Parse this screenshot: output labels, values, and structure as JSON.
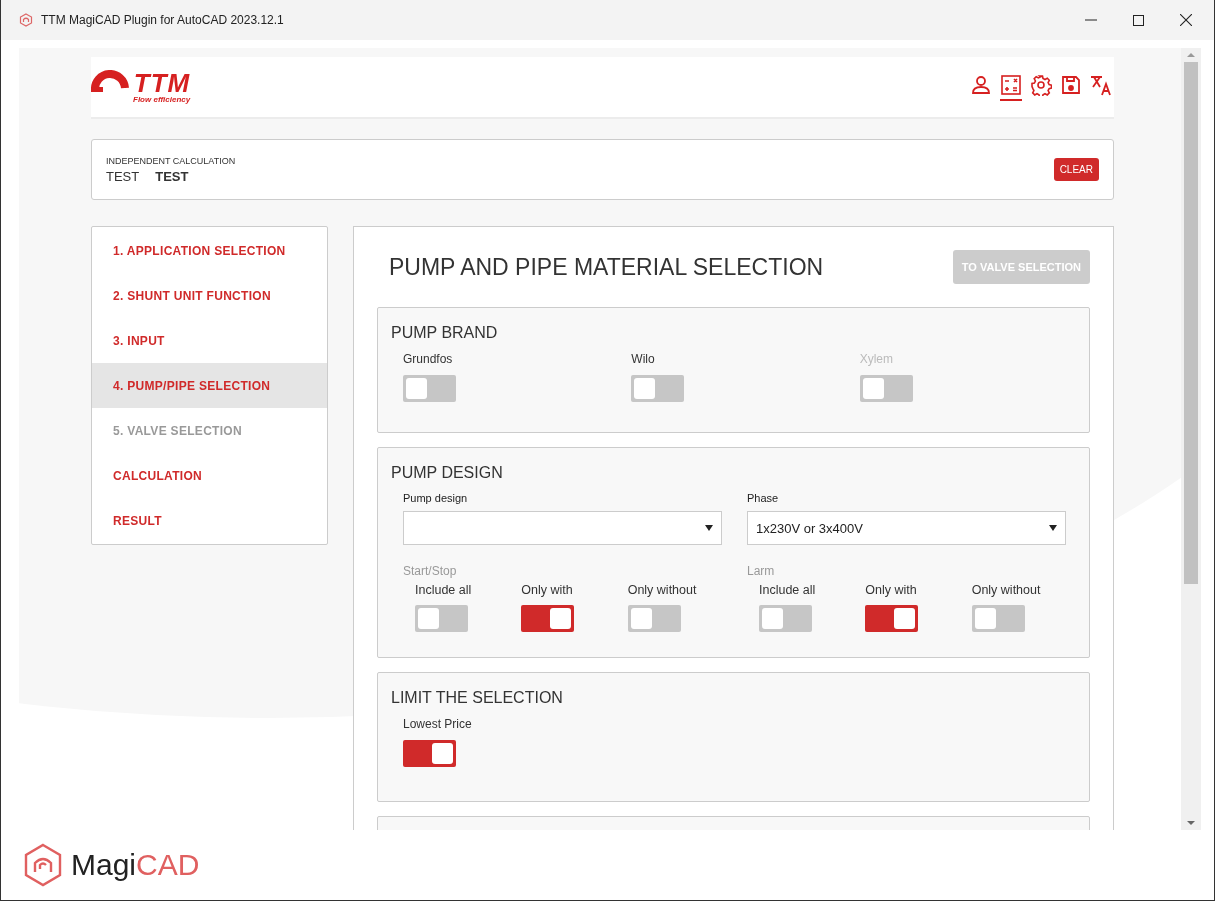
{
  "window": {
    "title": "TTM MagiCAD Plugin for AutoCAD 2023.12.1"
  },
  "header": {
    "logo": {
      "name": "TTM",
      "tagline": "Flow efficiency"
    },
    "icons": [
      {
        "kind": "user",
        "selected": false
      },
      {
        "kind": "calculator",
        "selected": true
      },
      {
        "kind": "gear",
        "selected": false
      },
      {
        "kind": "save",
        "selected": false
      },
      {
        "kind": "translate",
        "selected": false
      }
    ]
  },
  "info_card": {
    "label": "INDEPENDENT CALCULATION",
    "values": [
      "TEST",
      "TEST"
    ],
    "clear_button": "CLEAR"
  },
  "sidebar": {
    "items": [
      {
        "label": "1. APPLICATION SELECTION",
        "selected": false,
        "disabled": false
      },
      {
        "label": "2. SHUNT UNIT FUNCTION",
        "selected": false,
        "disabled": false
      },
      {
        "label": "3. INPUT",
        "selected": false,
        "disabled": false
      },
      {
        "label": "4. PUMP/PIPE SELECTION",
        "selected": true,
        "disabled": false
      },
      {
        "label": "5. VALVE SELECTION",
        "selected": false,
        "disabled": true
      },
      {
        "label": "CALCULATION",
        "selected": false,
        "disabled": false
      },
      {
        "label": "RESULT",
        "selected": false,
        "disabled": false
      }
    ]
  },
  "main": {
    "title": "PUMP AND PIPE MATERIAL SELECTION",
    "next_button": {
      "label": "TO VALVE SELECTION",
      "disabled": true
    },
    "pump_brand": {
      "title": "PUMP BRAND",
      "toggles": [
        {
          "label": "Grundfos",
          "on": false,
          "disabled": false
        },
        {
          "label": "Wilo",
          "on": false,
          "disabled": false
        },
        {
          "label": "Xylem",
          "on": false,
          "disabled": true
        }
      ]
    },
    "pump_design": {
      "title": "PUMP DESIGN",
      "selects": [
        {
          "label": "Pump design"
        },
        {
          "label": "Phase",
          "value": "1x230V or 3x400V"
        }
      ],
      "groups": [
        {
          "label": "Start/Stop",
          "toggles": [
            {
              "label": "Include all",
              "on": false
            },
            {
              "label": "Only with",
              "on": true
            },
            {
              "label": "Only without",
              "on": false
            }
          ]
        },
        {
          "label": "Larm",
          "toggles": [
            {
              "label": "Include all",
              "on": false
            },
            {
              "label": "Only with",
              "on": true
            },
            {
              "label": "Only without",
              "on": false
            }
          ]
        }
      ]
    },
    "limit": {
      "title": "LIMIT THE SELECTION",
      "toggles": [
        {
          "label": "Lowest Price",
          "on": true
        }
      ]
    }
  },
  "footer": {
    "logo": [
      {
        "text": "Magi",
        "accent": false
      },
      {
        "text": "CAD",
        "accent": true
      }
    ]
  }
}
